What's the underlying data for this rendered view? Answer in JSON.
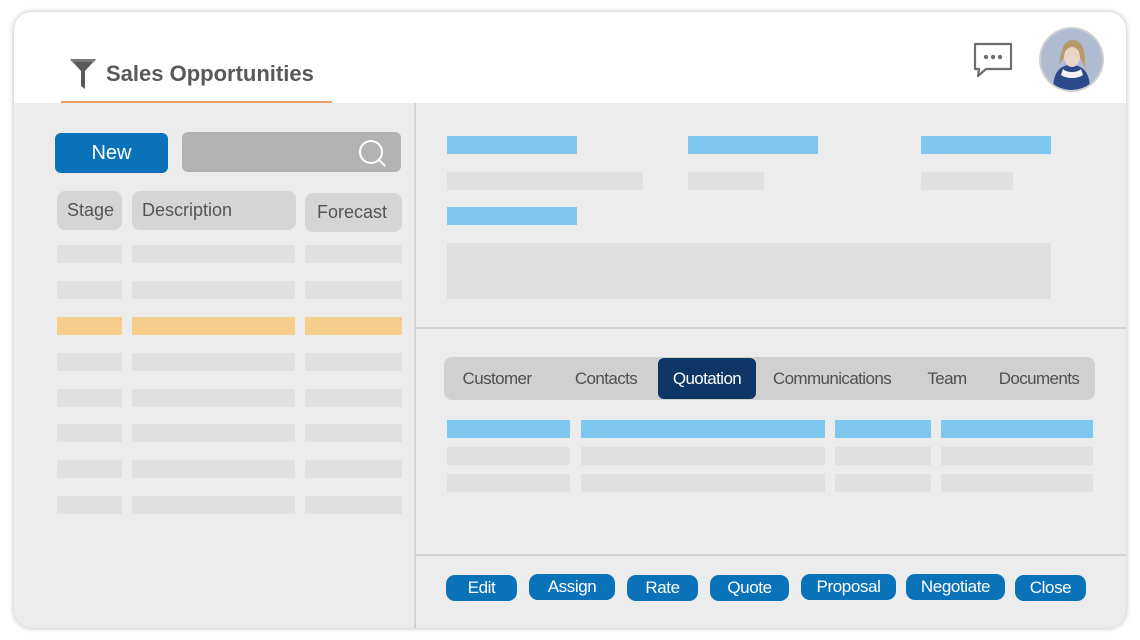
{
  "header": {
    "title": "Sales Opportunities",
    "icons": {
      "logo": "funnel-icon",
      "chat": "chat-bubble-icon",
      "user": "user-avatar"
    }
  },
  "left_panel": {
    "new_button_label": "New",
    "search": {
      "placeholder": "",
      "icon": "search-icon"
    },
    "columns": [
      "Stage",
      "Description",
      "Forecast"
    ],
    "selected_row_index": 2
  },
  "tabs": {
    "items": [
      "Customer",
      "Contacts",
      "Quotation",
      "Communications",
      "Team",
      "Documents"
    ],
    "active": "Quotation"
  },
  "actions": [
    "Edit",
    "Assign",
    "Rate",
    "Quote",
    "Proposal",
    "Negotiate",
    "Close"
  ],
  "colors": {
    "primary": "#0a72b8",
    "active_tab": "#0d3666",
    "highlight_row": "#f7cd8b",
    "accent_underline": "#e8a060",
    "placeholder_label": "#7ec8f0"
  }
}
